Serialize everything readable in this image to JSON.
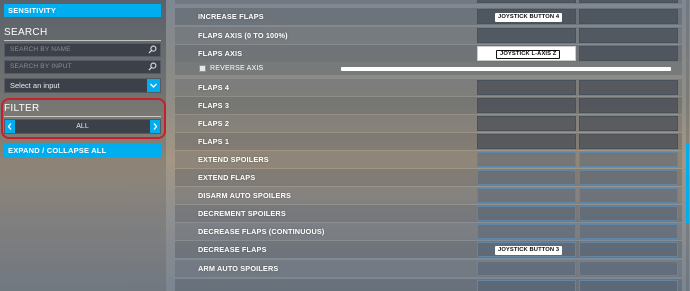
{
  "left_panel": {
    "sensitivity_label": "SENSITIVITY",
    "search_title": "SEARCH",
    "search_by_name_placeholder": "SEARCH BY NAME",
    "search_by_input_placeholder": "SEARCH BY INPUT",
    "select_input_value": "Select an input",
    "filter_title": "FILTER",
    "filter_value": "ALL",
    "expand_collapse_label": "EXPAND / COLLAPSE ALL"
  },
  "bindings": [
    {
      "label": "INCREASE FLAPS",
      "input1": "JOYSTICK BUTTON 4",
      "input2": ""
    },
    {
      "label": "FLAPS AXIS (0 TO 100%)",
      "input1": "",
      "input2": ""
    },
    {
      "label": "FLAPS AXIS",
      "input1": "JOYSTICK L-AXIS Z",
      "input2": ""
    },
    {
      "label": "FLAPS 4",
      "input1": "",
      "input2": ""
    },
    {
      "label": "FLAPS 3",
      "input1": "",
      "input2": ""
    },
    {
      "label": "FLAPS 2",
      "input1": "",
      "input2": ""
    },
    {
      "label": "FLAPS 1",
      "input1": "",
      "input2": ""
    },
    {
      "label": "EXTEND SPOILERS",
      "input1": "",
      "input2": ""
    },
    {
      "label": "EXTEND FLAPS",
      "input1": "",
      "input2": ""
    },
    {
      "label": "DISARM AUTO SPOILERS",
      "input1": "",
      "input2": ""
    },
    {
      "label": "DECREMENT SPOILERS",
      "input1": "",
      "input2": ""
    },
    {
      "label": "DECREASE FLAPS (CONTINUOUS)",
      "input1": "",
      "input2": ""
    },
    {
      "label": "DECREASE FLAPS",
      "input1": "JOYSTICK BUTTON 3",
      "input2": ""
    },
    {
      "label": "ARM AUTO SPOILERS",
      "input1": "",
      "input2": ""
    }
  ],
  "reverse_axis_label": "REVERSE AXIS",
  "colors": {
    "accent": "#00adef",
    "highlight": "#c8202a"
  }
}
